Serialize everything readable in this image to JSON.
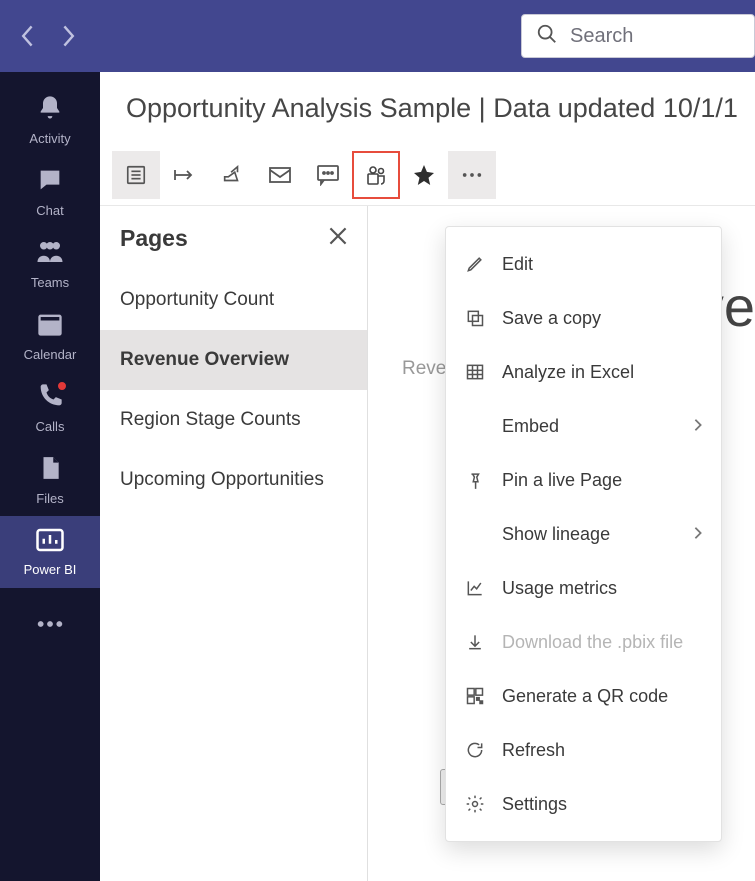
{
  "search": {
    "placeholder": "Search"
  },
  "rail": {
    "items": [
      {
        "label": "Activity"
      },
      {
        "label": "Chat"
      },
      {
        "label": "Teams"
      },
      {
        "label": "Calendar"
      },
      {
        "label": "Calls"
      },
      {
        "label": "Files"
      },
      {
        "label": "Power BI"
      }
    ]
  },
  "header": {
    "title": "Opportunity Analysis Sample  |  Data updated 10/1/1"
  },
  "pages": {
    "title": "Pages",
    "items": [
      {
        "label": "Opportunity Count"
      },
      {
        "label": "Revenue Overview"
      },
      {
        "label": "Region Stage Counts"
      },
      {
        "label": "Upcoming Opportunities"
      }
    ]
  },
  "canvas": {
    "partial1": "ve",
    "partial2": "Reve"
  },
  "menu": {
    "edit": "Edit",
    "save_copy": "Save a copy",
    "analyze": "Analyze in Excel",
    "embed": "Embed",
    "pin": "Pin a live Page",
    "lineage": "Show lineage",
    "usage": "Usage metrics",
    "download": "Download the .pbix file",
    "qr": "Generate a QR code",
    "refresh": "Refresh",
    "settings": "Settings"
  }
}
